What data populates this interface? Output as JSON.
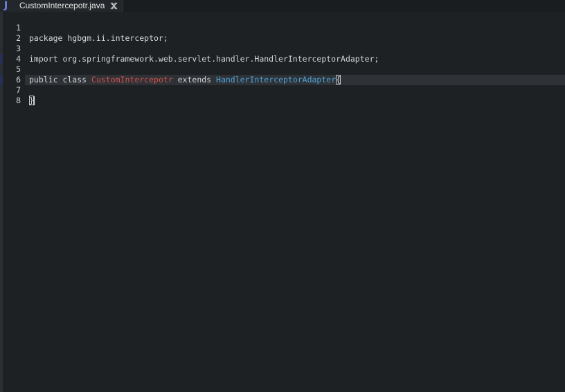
{
  "tab": {
    "icon": "J",
    "title": "CustomIntercepotr.java",
    "close_icon": "close-icon"
  },
  "lines": [
    {
      "number": "1",
      "segments": [
        "package hgbgm.ii.interceptor;"
      ]
    },
    {
      "number": "2",
      "segments": [
        ""
      ]
    },
    {
      "number": "3",
      "segments": [
        "import org.springframework.web.servlet.handler.HandlerInterceptorAdapter;"
      ]
    },
    {
      "number": "4",
      "segments": [
        ""
      ]
    },
    {
      "number": "5",
      "segments": [
        "public class ",
        "CustomIntercepotr",
        " extends ",
        "HandlerInterceptorAdapter",
        "{"
      ]
    },
    {
      "number": "6",
      "segments": [
        ""
      ]
    },
    {
      "number": "7",
      "segments": [
        "}"
      ]
    },
    {
      "number": "8",
      "segments": [
        ""
      ]
    }
  ],
  "colors": {
    "background": "#1e2124",
    "class_name": "#d4504b",
    "super_class": "#4ea3d9",
    "java_icon": "#6f84e6"
  }
}
